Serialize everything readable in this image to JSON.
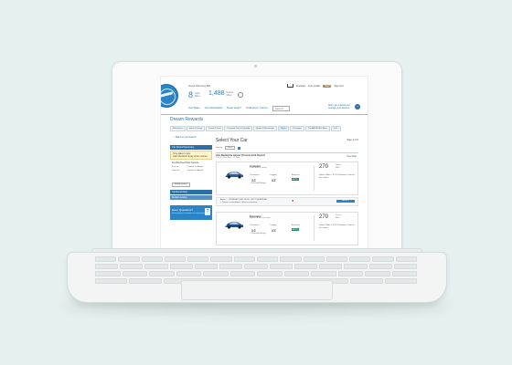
{
  "header": {
    "greeting": "Good Morning Bill,",
    "miles_count": "8",
    "miles_label": "Cash Miles",
    "dream_count": "1,488",
    "dream_label": "Dream Miles",
    "info_glyph": "i",
    "util_links": [
      "Français",
      "Your profile",
      "Sign Out"
    ],
    "badge": "Gold",
    "help_text": "Shop, get support and manage your account",
    "help_glyph": "?"
  },
  "nav": [
    "Get Miles",
    "Get Rewarded",
    "Need Help?",
    "Collectors' Corner",
    "Search"
  ],
  "dream_rewards": "Dream Rewards",
  "tabs": [
    "Electronics",
    "Home & Living",
    "Travel & Gear",
    "Personal Care & Lifestyle",
    "Sports & Recreation",
    "Flights",
    "Packages",
    "The AIR MILES Store",
    "Hotels",
    "Cars",
    "& M..."
  ],
  "back_link": "< Back to Car Search",
  "sidebar": {
    "head": "Car Rental Summary",
    "sub_title": "Time taken to pay:",
    "sub_note": "Cash Rewards & pay at the counter",
    "sub2": "Flexible/Fixed Rate Sample",
    "pickup_label": "Pick up",
    "pickup_value": "Toronto Int Airport",
    "dropoff_label": "Drop off",
    "dropoff_value": "Toronto Int Airport",
    "modify": "Modify search",
    "link1": "Car Rental FAQ",
    "link2": "Rental Location",
    "questions_title": "Have Questions?",
    "questions_sub": "Find answers to common car rental questions"
  },
  "main": {
    "title": "Select Your Car",
    "step": "Step 1 of 5",
    "sort_label": "Sort by",
    "sort_value": "Price",
    "loc_title": "Avis Rental Car Airport (Toronto Intnl Airport)",
    "loc_sub": "2 dr, 1.1 Pax, Feb + 17 days",
    "map_link": "View Map",
    "cars": [
      {
        "name": "Compact",
        "sub": "Ford Focus or similar",
        "passengers_label": "Passengers",
        "passengers": "x4",
        "luggage_label": "Luggage",
        "luggage": "x2",
        "feature_label": "Automatic",
        "feature": "AUTO",
        "unlimited": "+ Unlimited Mileage",
        "price": "270",
        "price_unit": "Dream Miles",
        "price_note": "Rental 3 Miles + $ 52.54 Redeem 3 miles at the counter.",
        "pickup_info": "Airport — TERMINAL ROAD LEVEL, SHUTTLE ARRIVAL",
        "pickup_info2": "+ Distance to the Airport: 1.4km from location",
        "select": "SELECT"
      },
      {
        "name": "Economy",
        "sub": "Hyundai Accent or similar",
        "passengers_label": "Passengers",
        "passengers": "x4",
        "luggage_label": "Luggage",
        "luggage": "x2",
        "feature_label": "Automatic",
        "feature": "AUTO",
        "unlimited": "+ Unlimited Mileage",
        "price": "270",
        "price_unit": "Dream Miles",
        "price_note": "Rental 3 Miles + $ 52.54 Redeem 3 miles at the counter."
      }
    ]
  }
}
